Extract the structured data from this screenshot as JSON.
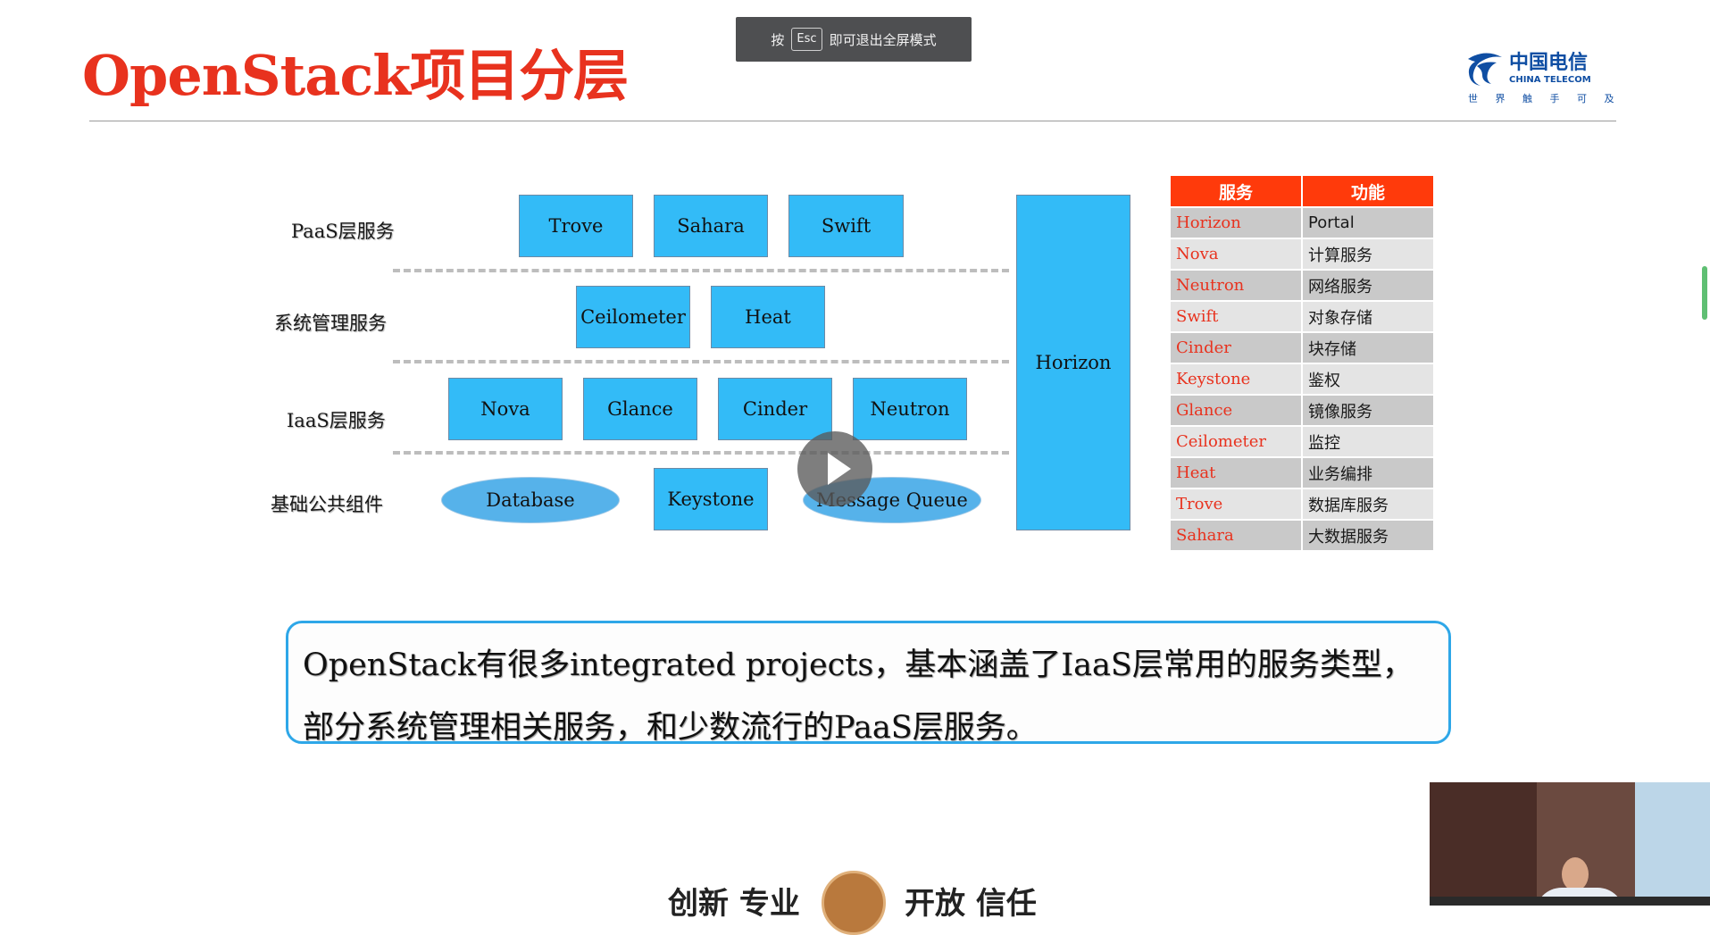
{
  "slide": {
    "title": "OpenStack项目分层",
    "logo": {
      "cn": "中国电信",
      "en": "CHINA TELECOM",
      "slogan": "世 界 触 手 可 及"
    }
  },
  "fullscreen_notice": {
    "prefix": "按",
    "key": "Esc",
    "suffix": "即可退出全屏模式"
  },
  "layers": [
    {
      "label": "PaaS层服务",
      "boxes": [
        "Trove",
        "Sahara",
        "Swift"
      ]
    },
    {
      "label": "系统管理服务",
      "boxes": [
        "Ceilometer",
        "Heat"
      ]
    },
    {
      "label": "IaaS层服务",
      "boxes": [
        "Nova",
        "Glance",
        "Cinder",
        "Neutron"
      ]
    },
    {
      "label": "基础公共组件",
      "boxes": [
        "Database",
        "Keystone",
        "Message Queue"
      ]
    }
  ],
  "horizon_box": "Horizon",
  "service_table": {
    "headers": [
      "服务",
      "功能"
    ],
    "rows": [
      [
        "Horizon",
        "Portal"
      ],
      [
        "Nova",
        "计算服务"
      ],
      [
        "Neutron",
        "网络服务"
      ],
      [
        "Swift",
        "对象存储"
      ],
      [
        "Cinder",
        "块存储"
      ],
      [
        "Keystone",
        "鉴权"
      ],
      [
        "Glance",
        "镜像服务"
      ],
      [
        "Ceilometer",
        "监控"
      ],
      [
        "Heat",
        "业务编排"
      ],
      [
        "Trove",
        "数据库服务"
      ],
      [
        "Sahara",
        "大数据服务"
      ]
    ]
  },
  "callout": {
    "line1": "OpenStack有很多integrated projects，基本涵盖了IaaS层常用的服务类型，",
    "line2": "部分系统管理相关服务，和少数流行的PaaS层服务。"
  },
  "footer": {
    "left": "创新 专业",
    "right": "开放 信任"
  },
  "colors": {
    "title_red": "#e8321e",
    "box_blue": "#33bbf7",
    "table_header": "#ff3a0b",
    "callout_border": "#2ea7e8"
  }
}
